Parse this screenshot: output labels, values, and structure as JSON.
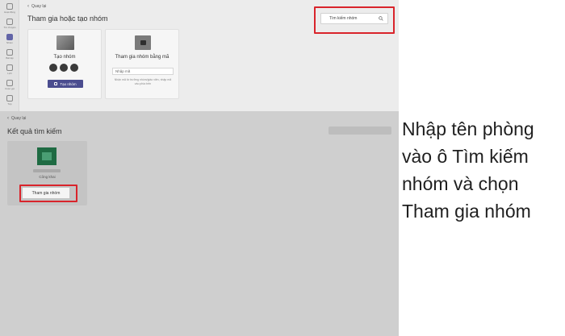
{
  "sidebar": {
    "items": [
      {
        "label": "Hoạt động",
        "icon": "bell-icon",
        "active": false
      },
      {
        "label": "Trò chuyện",
        "icon": "chat-icon",
        "active": false
      },
      {
        "label": "Nhóm",
        "icon": "teams-icon",
        "active": true
      },
      {
        "label": "Bài tập",
        "icon": "assignments-icon",
        "active": false
      },
      {
        "label": "Lịch",
        "icon": "calendar-icon",
        "active": false
      },
      {
        "label": "Cuộc gọi",
        "icon": "phone-icon",
        "active": false
      },
      {
        "label": "Tệp",
        "icon": "file-icon",
        "active": false
      }
    ]
  },
  "top": {
    "back_label": "Quay lại",
    "title": "Tham gia hoặc tạo nhóm",
    "search": {
      "placeholder": "Tìm kiếm nhóm"
    },
    "create_card": {
      "title": "Tạo nhóm",
      "button_label": "Tạo nhóm"
    },
    "join_card": {
      "title": "Tham gia nhóm bằng mã",
      "code_placeholder": "Nhập mã",
      "hint": "Nhận mã từ trưởng nhóm/giáo viên, nhập mã vào phía trên"
    }
  },
  "bottom": {
    "back_label": "Quay lại",
    "title": "Kết quả tìm kiếm",
    "result": {
      "type_label": "Công khai",
      "join_label": "Tham gia nhóm"
    }
  },
  "caption": {
    "lines": [
      "Nhập tên phòng",
      "vào ô Tìm kiếm",
      "nhóm và chọn",
      "Tham gia nhóm"
    ]
  },
  "colors": {
    "highlight": "#d9242b",
    "brand": "#4b4d8f",
    "team_logo": "#1f6b43"
  }
}
